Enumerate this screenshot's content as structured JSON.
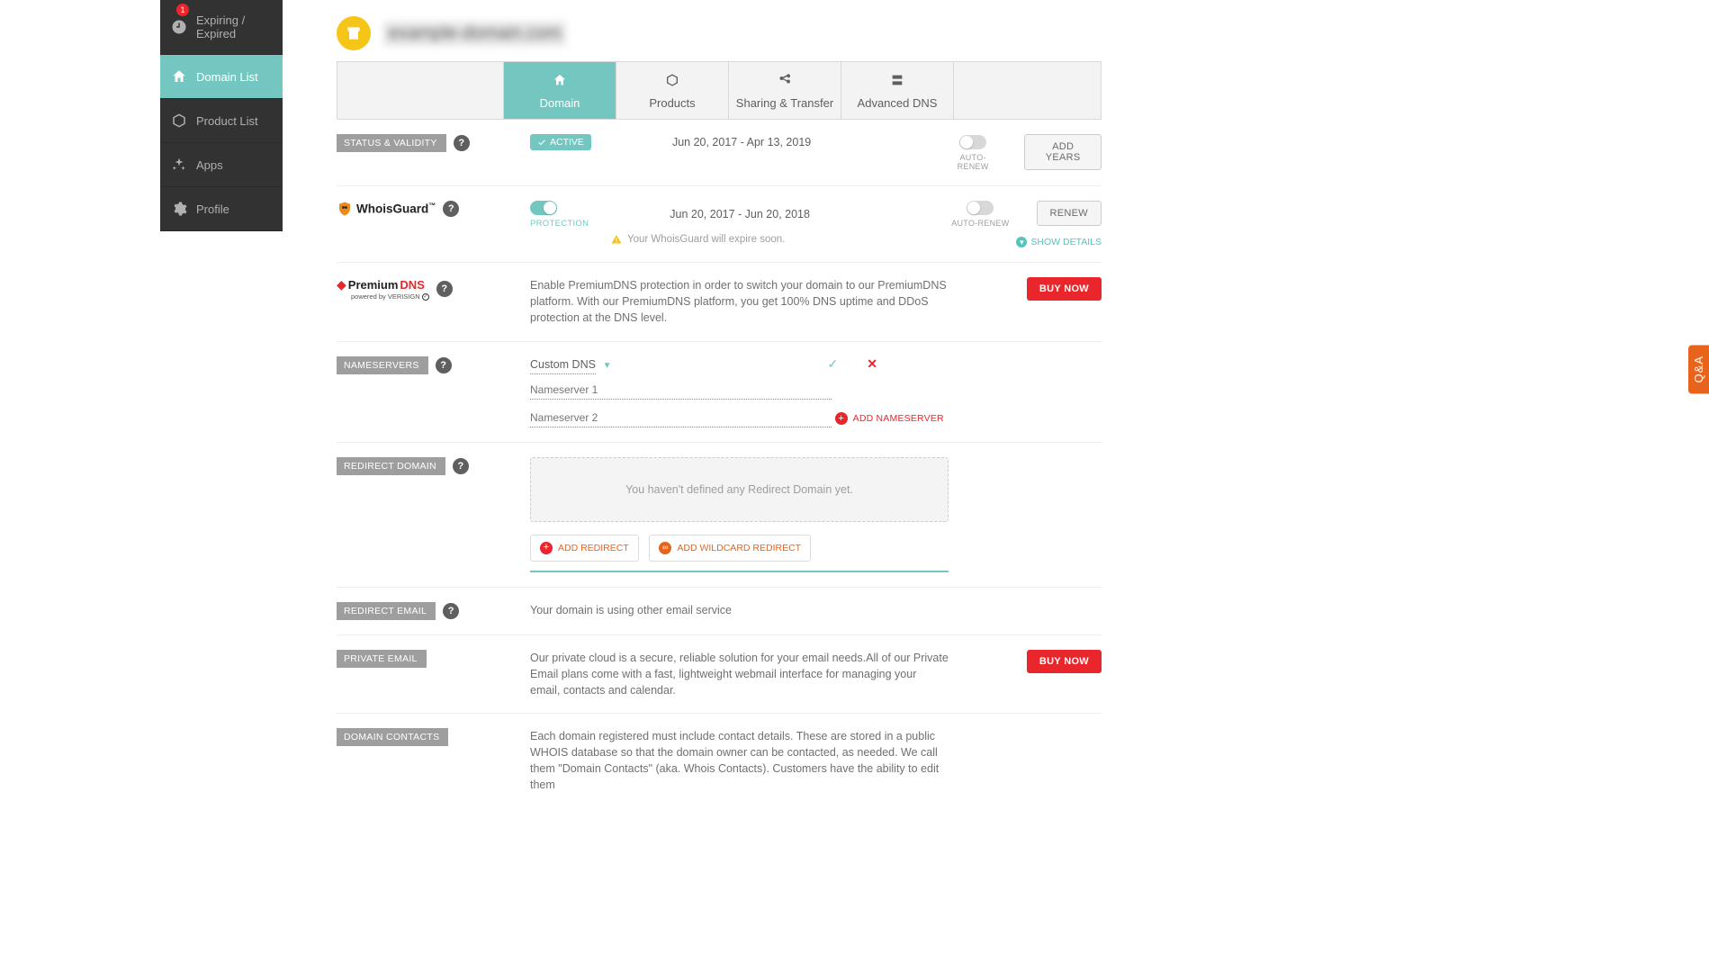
{
  "sidebar": {
    "items": [
      {
        "label": "Expiring / Expired",
        "badge": "1"
      },
      {
        "label": "Domain List"
      },
      {
        "label": "Product List"
      },
      {
        "label": "Apps"
      },
      {
        "label": "Profile"
      }
    ]
  },
  "tabs": {
    "domain": "Domain",
    "products": "Products",
    "sharing": "Sharing & Transfer",
    "advanced": "Advanced DNS"
  },
  "status": {
    "chip": "STATUS & VALIDITY",
    "badge": "ACTIVE",
    "dates": "Jun 20, 2017 - Apr 13, 2019",
    "autorenew": "AUTO-RENEW",
    "button": "ADD YEARS"
  },
  "whois": {
    "logo_text": "WhoisGuard",
    "tm": "™",
    "protection": "PROTECTION",
    "dates": "Jun 20, 2017 - Jun 20, 2018",
    "warn": "Your WhoisGuard will expire soon.",
    "autorenew": "AUTO-RENEW",
    "button": "RENEW",
    "show_details": "SHOW DETAILS"
  },
  "pdns": {
    "logo_premium": "Premium",
    "logo_dns": "DNS",
    "powered": "powered by VERISIGN",
    "desc": "Enable PremiumDNS protection in order to switch your domain to our PremiumDNS platform. With our PremiumDNS platform, you get 100% DNS uptime and DDoS protection at the DNS level.",
    "button": "BUY NOW"
  },
  "ns": {
    "chip": "NAMESERVERS",
    "select_value": "Custom DNS",
    "ph1": "Nameserver 1",
    "ph2": "Nameserver 2",
    "add": "ADD NAMESERVER"
  },
  "redirect": {
    "chip": "REDIRECT DOMAIN",
    "empty": "You haven't defined any Redirect Domain yet.",
    "add": "ADD REDIRECT",
    "add_wild": "ADD WILDCARD REDIRECT"
  },
  "remail": {
    "chip": "REDIRECT EMAIL",
    "desc": "Your domain is using other email service"
  },
  "pemail": {
    "chip": "PRIVATE EMAIL",
    "desc": "Our private cloud is a secure, reliable solution for your email needs.All of our Private Email plans come with a fast, lightweight webmail interface for managing your email, contacts and calendar.",
    "button": "BUY NOW"
  },
  "contacts": {
    "chip": "DOMAIN CONTACTS",
    "desc": "Each domain registered must include contact details. These are stored in a public WHOIS database so that the domain owner can be contacted, as needed. We call them \"Domain Contacts\" (aka. Whois Contacts). Customers have the ability to edit them"
  },
  "qa": "Q&A",
  "help": "?"
}
